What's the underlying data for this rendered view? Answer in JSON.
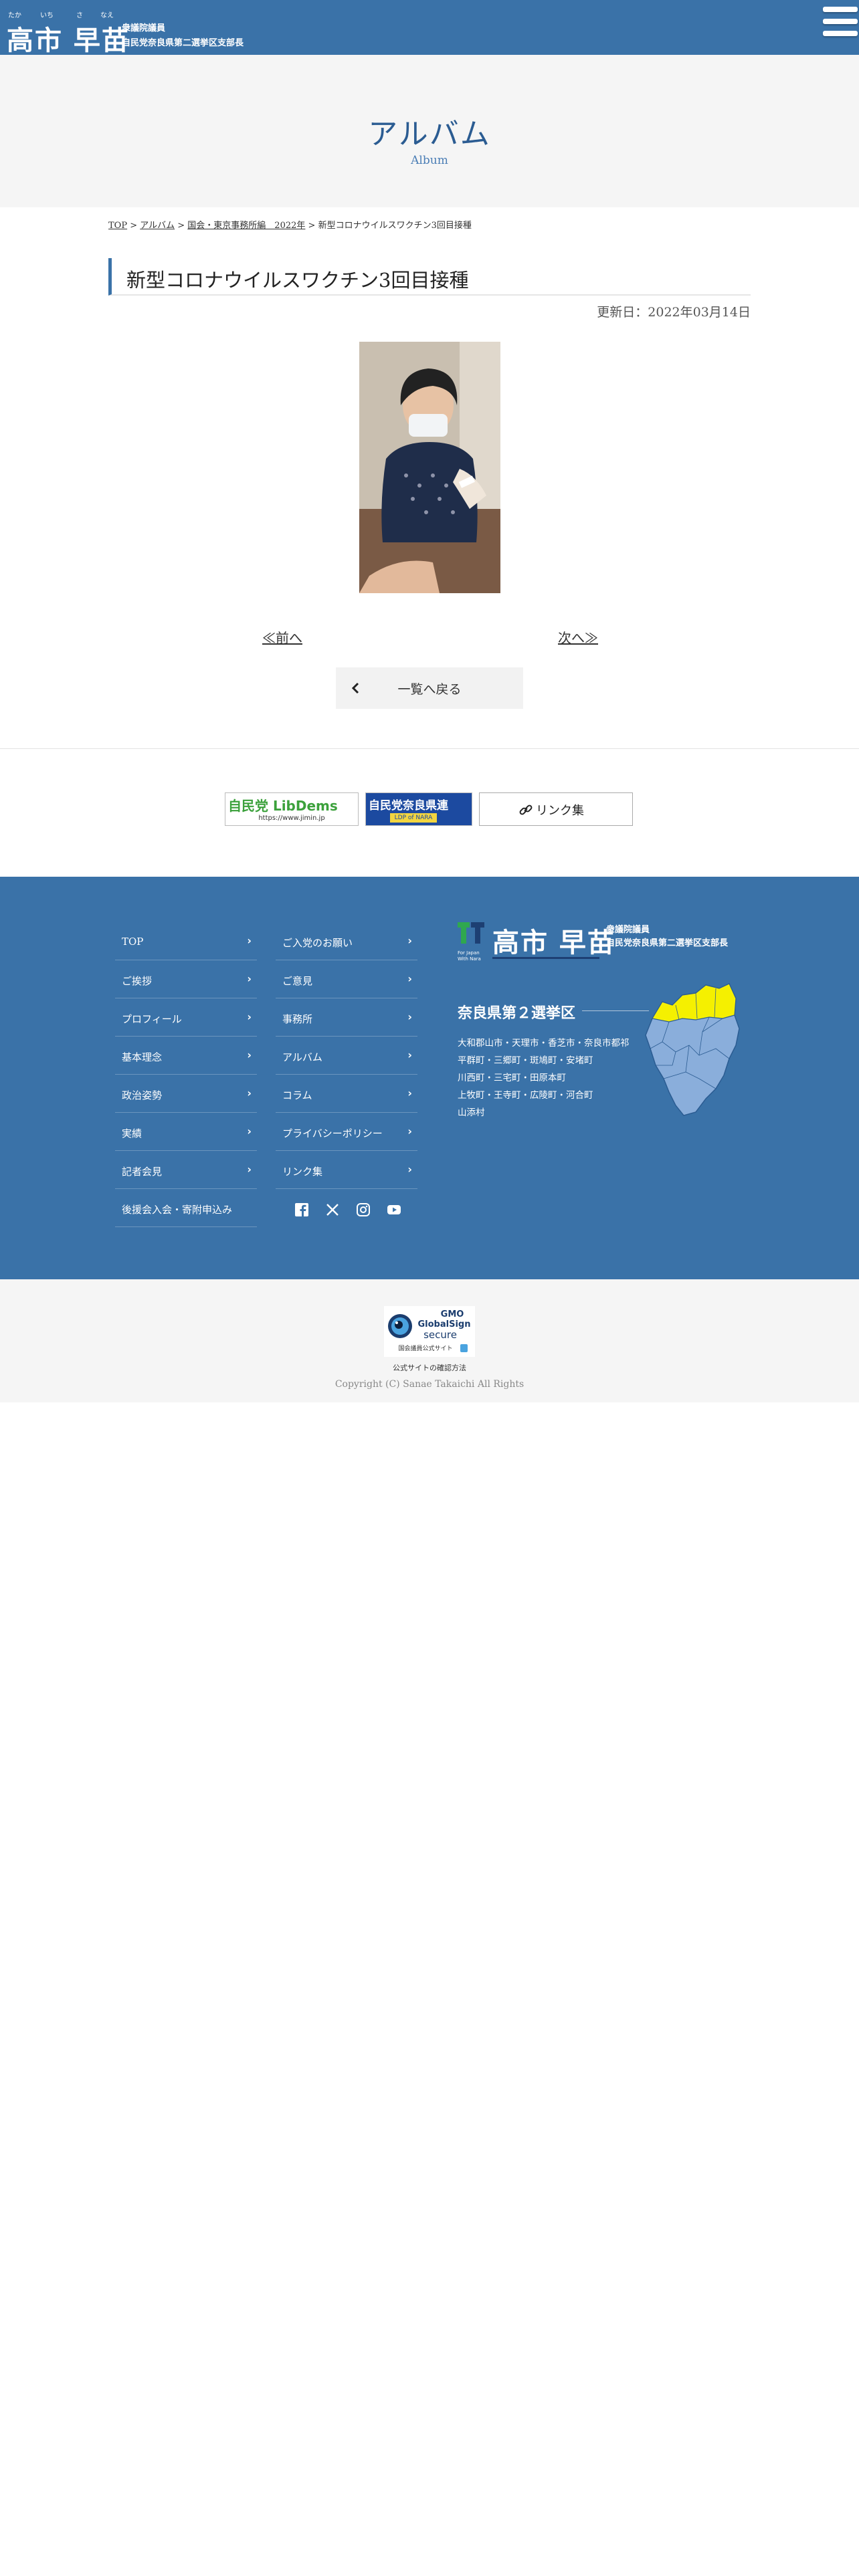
{
  "header": {
    "ruby": [
      "たか",
      "いち",
      "さ",
      "なえ"
    ],
    "name": "高市 早苗",
    "subtitle_line1": "衆議院議員",
    "subtitle_line2": "自民党奈良県第二選挙区支部長",
    "menu_icon": "hamburger-icon"
  },
  "hero": {
    "title": "アルバム",
    "subtitle": "Album"
  },
  "breadcrumb": {
    "items": [
      "TOP",
      "アルバム",
      "国会・東京事務所編　2022年"
    ],
    "separator": " > ",
    "current": "新型コロナウイルスワクチン3回目接種"
  },
  "article": {
    "title": "新型コロナウイルスワクチン3回目接種",
    "updated": "更新日：2022年03月14日",
    "photo_alt": "新型コロナウイルスワクチン3回目接種"
  },
  "pager": {
    "prev": "≪前へ",
    "next": "次へ≫",
    "back": "一覧へ戻る"
  },
  "banners": {
    "jimin_title": "自民党 LibDems",
    "jimin_url": "https://www.jimin.jp",
    "nara_title": "自民党奈良県連",
    "nara_sub": "LDP of NARA",
    "links_label": "リンク集"
  },
  "footer": {
    "nav_col1": [
      "TOP",
      "ご挨拶",
      "プロフィール",
      "基本理念",
      "政治姿勢",
      "実績",
      "記者会見",
      "後援会入会・寄附申込み"
    ],
    "nav_col2": [
      "ご入党のお願い",
      "ご意見",
      "事務所",
      "アルバム",
      "コラム",
      "プライバシーポリシー",
      "リンク集"
    ],
    "social": [
      "facebook-icon",
      "x-icon",
      "instagram-icon",
      "youtube-icon"
    ],
    "logo_tag": "For Japan With Nara",
    "name": "高市 早苗",
    "subtitle_line1": "衆議院議員",
    "subtitle_line2": "自民党奈良県第二選挙区支部長",
    "district": "奈良県第２選挙区",
    "areas": [
      "大和郡山市・天理市・香芝市・奈良市都祁",
      "平群町・三郷町・斑鳩町・安堵町",
      "川西町・三宅町・田原本町",
      "上牧町・王寺町・広陵町・河合町",
      "山添村"
    ]
  },
  "bottom": {
    "seal_brand": "GMO",
    "seal_name": "GlobalSign",
    "seal_secure": "secure",
    "seal_sub": "国会議員公式サイト",
    "note": "公式サイトの確認方法",
    "copyright": "Copyright (C) Sanae Takaichi All Rights"
  },
  "colors": {
    "brand_blue": "#3a72a8",
    "title_blue": "#2b5c92",
    "map_highlight": "#f5f000"
  }
}
